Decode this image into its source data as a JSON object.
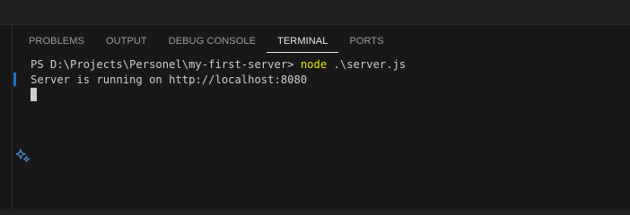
{
  "panel": {
    "tabs": [
      {
        "label": "PROBLEMS"
      },
      {
        "label": "OUTPUT"
      },
      {
        "label": "DEBUG CONSOLE"
      },
      {
        "label": "TERMINAL"
      },
      {
        "label": "PORTS"
      }
    ],
    "active_tab": "TERMINAL"
  },
  "terminal": {
    "prompt": "PS D:\\Projects\\Personel\\my-first-server> ",
    "command": "node",
    "args": " .\\server.js",
    "output": "Server is running on http://localhost:8080"
  },
  "icons": {
    "gutter": "sparkle-icon"
  },
  "colors": {
    "panel_bg": "#181818",
    "editor_bg": "#1f1f1f",
    "text": "#cccccc",
    "command": "#e5e510",
    "decoration": "#2472c8",
    "tab_inactive": "#9d9d9d",
    "tab_active": "#e7e7e7"
  }
}
